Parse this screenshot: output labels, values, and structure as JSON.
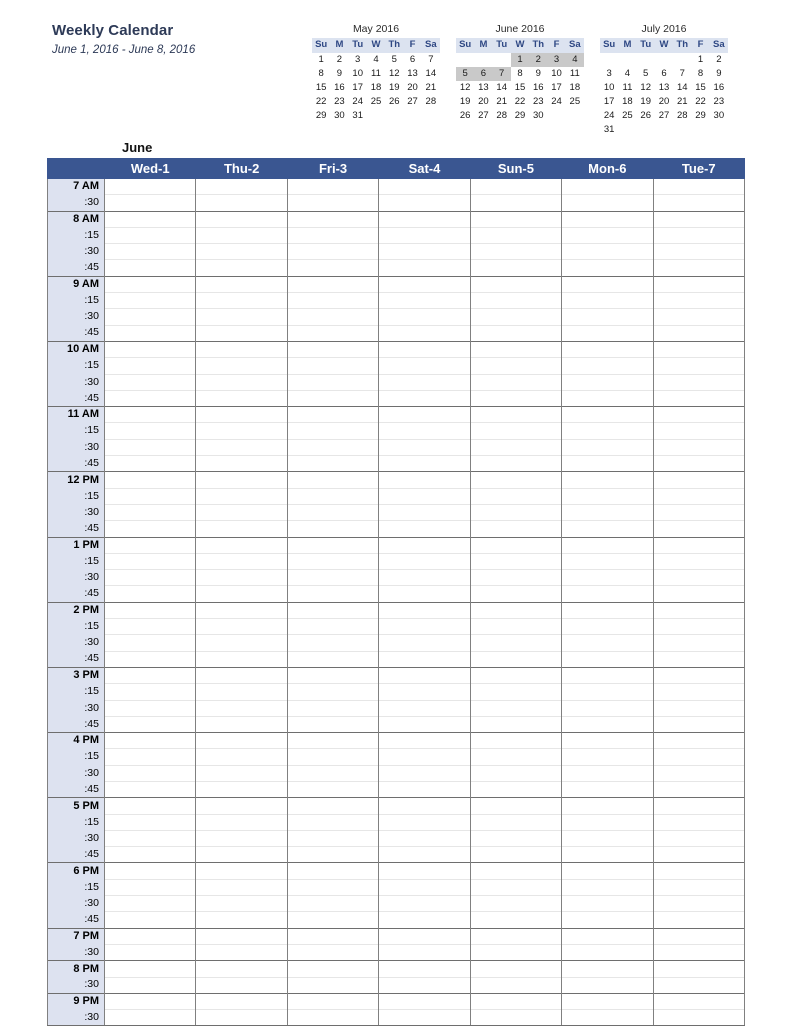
{
  "header": {
    "title": "Weekly Calendar",
    "subtitle": "June 1, 2016 - June 8, 2016"
  },
  "colors": {
    "header_blue": "#3a5691",
    "time_col_bg": "#dde2f0",
    "mini_head_bg": "#dce3f0",
    "mini_highlight": "#c9c9c9",
    "title_text": "#2d3a57"
  },
  "mini_calendars": [
    {
      "name": "may-2016",
      "title": "May 2016",
      "weekdays": [
        "Su",
        "M",
        "Tu",
        "W",
        "Th",
        "F",
        "Sa"
      ],
      "weeks": [
        [
          "1",
          "2",
          "3",
          "4",
          "5",
          "6",
          "7"
        ],
        [
          "8",
          "9",
          "10",
          "11",
          "12",
          "13",
          "14"
        ],
        [
          "15",
          "16",
          "17",
          "18",
          "19",
          "20",
          "21"
        ],
        [
          "22",
          "23",
          "24",
          "25",
          "26",
          "27",
          "28"
        ],
        [
          "29",
          "30",
          "31",
          "",
          "",
          "",
          ""
        ]
      ],
      "highlighted": []
    },
    {
      "name": "june-2016",
      "title": "June 2016",
      "weekdays": [
        "Su",
        "M",
        "Tu",
        "W",
        "Th",
        "F",
        "Sa"
      ],
      "weeks": [
        [
          "",
          "",
          "",
          "1",
          "2",
          "3",
          "4"
        ],
        [
          "5",
          "6",
          "7",
          "8",
          "9",
          "10",
          "11"
        ],
        [
          "12",
          "13",
          "14",
          "15",
          "16",
          "17",
          "18"
        ],
        [
          "19",
          "20",
          "21",
          "22",
          "23",
          "24",
          "25"
        ],
        [
          "26",
          "27",
          "28",
          "29",
          "30",
          "",
          ""
        ]
      ],
      "highlighted": [
        "1",
        "2",
        "3",
        "4",
        "5",
        "6",
        "7"
      ]
    },
    {
      "name": "july-2016",
      "title": "July 2016",
      "weekdays": [
        "Su",
        "M",
        "Tu",
        "W",
        "Th",
        "F",
        "Sa"
      ],
      "weeks": [
        [
          "",
          "",
          "",
          "",
          "",
          "1",
          "2"
        ],
        [
          "3",
          "4",
          "5",
          "6",
          "7",
          "8",
          "9"
        ],
        [
          "10",
          "11",
          "12",
          "13",
          "14",
          "15",
          "16"
        ],
        [
          "17",
          "18",
          "19",
          "20",
          "21",
          "22",
          "23"
        ],
        [
          "24",
          "25",
          "26",
          "27",
          "28",
          "29",
          "30"
        ],
        [
          "31",
          "",
          "",
          "",
          "",
          "",
          ""
        ]
      ],
      "highlighted": []
    }
  ],
  "grid": {
    "month_label": "June",
    "day_columns": [
      "Wed-1",
      "Thu-2",
      "Fri-3",
      "Sat-4",
      "Sun-5",
      "Mon-6",
      "Tue-7"
    ],
    "hours": [
      {
        "label": "7 AM",
        "subs": [
          ":30"
        ]
      },
      {
        "label": "8 AM",
        "subs": [
          ":15",
          ":30",
          ":45"
        ]
      },
      {
        "label": "9 AM",
        "subs": [
          ":15",
          ":30",
          ":45"
        ]
      },
      {
        "label": "10 AM",
        "subs": [
          ":15",
          ":30",
          ":45"
        ]
      },
      {
        "label": "11 AM",
        "subs": [
          ":15",
          ":30",
          ":45"
        ]
      },
      {
        "label": "12 PM",
        "subs": [
          ":15",
          ":30",
          ":45"
        ]
      },
      {
        "label": "1 PM",
        "subs": [
          ":15",
          ":30",
          ":45"
        ]
      },
      {
        "label": "2 PM",
        "subs": [
          ":15",
          ":30",
          ":45"
        ]
      },
      {
        "label": "3 PM",
        "subs": [
          ":15",
          ":30",
          ":45"
        ]
      },
      {
        "label": "4 PM",
        "subs": [
          ":15",
          ":30",
          ":45"
        ]
      },
      {
        "label": "5 PM",
        "subs": [
          ":15",
          ":30",
          ":45"
        ]
      },
      {
        "label": "6 PM",
        "subs": [
          ":15",
          ":30",
          ":45"
        ]
      },
      {
        "label": "7 PM",
        "subs": [
          ":30"
        ]
      },
      {
        "label": "8 PM",
        "subs": [
          ":30"
        ]
      },
      {
        "label": "9 PM",
        "subs": [
          ":30"
        ]
      }
    ]
  }
}
